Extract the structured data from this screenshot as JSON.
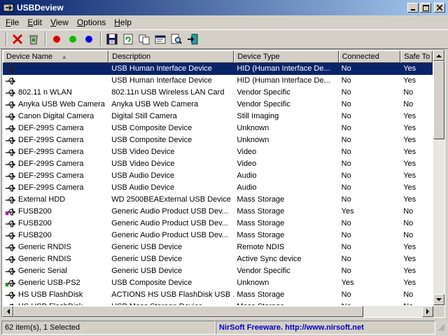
{
  "window": {
    "title": "USBDeview"
  },
  "menu": [
    {
      "label": "File",
      "u": "F",
      "rest": "ile"
    },
    {
      "label": "Edit",
      "u": "E",
      "rest": "dit"
    },
    {
      "label": "View",
      "u": "V",
      "rest": "iew"
    },
    {
      "label": "Options",
      "u": "O",
      "rest": "ptions"
    },
    {
      "label": "Help",
      "u": "H",
      "rest": "elp"
    }
  ],
  "toolbar": {
    "icons": [
      "delete-icon",
      "recycle-icon",
      "red-dot-icon",
      "green-dot-icon",
      "blue-dot-icon",
      "save-icon",
      "refresh-icon",
      "copy-icon",
      "properties-icon",
      "find-icon",
      "exit-icon"
    ],
    "colors": {
      "red": "#e00000",
      "green": "#00c000",
      "blue": "#0000e0"
    }
  },
  "columns": [
    "Device Name",
    "Description",
    "Device Type",
    "Connected",
    "Safe To"
  ],
  "rows": [
    {
      "name": "",
      "desc": "USB Human Interface Device",
      "type": "HID (Human Interface De...",
      "connected": "No",
      "safe": "Yes",
      "icon": "usb-icon",
      "selected": true
    },
    {
      "name": "",
      "desc": "USB Human Interface Device",
      "type": "HID (Human Interface De...",
      "connected": "No",
      "safe": "Yes",
      "icon": "usb-icon"
    },
    {
      "name": "802.11 n WLAN",
      "desc": "802.11n USB Wireless LAN Card",
      "type": "Vendor Specific",
      "connected": "No",
      "safe": "No",
      "icon": "usb-icon"
    },
    {
      "name": "Anyka USB Web Camera",
      "desc": "Anyka USB Web Camera",
      "type": "Vendor Specific",
      "connected": "No",
      "safe": "No",
      "icon": "usb-icon"
    },
    {
      "name": "Canon Digital Camera",
      "desc": "Digital Still Camera",
      "type": "Still Imaging",
      "connected": "No",
      "safe": "Yes",
      "icon": "usb-icon"
    },
    {
      "name": "DEF-299S Camera",
      "desc": "USB Composite Device",
      "type": "Unknown",
      "connected": "No",
      "safe": "Yes",
      "icon": "usb-icon"
    },
    {
      "name": "DEF-299S Camera",
      "desc": "USB Composite Device",
      "type": "Unknown",
      "connected": "No",
      "safe": "Yes",
      "icon": "usb-icon"
    },
    {
      "name": "DEF-299S Camera",
      "desc": "USB Video Device",
      "type": "Video",
      "connected": "No",
      "safe": "Yes",
      "icon": "usb-icon"
    },
    {
      "name": "DEF-299S Camera",
      "desc": "USB Video Device",
      "type": "Video",
      "connected": "No",
      "safe": "Yes",
      "icon": "usb-icon"
    },
    {
      "name": "DEF-299S Camera",
      "desc": "USB Audio Device",
      "type": "Audio",
      "connected": "No",
      "safe": "Yes",
      "icon": "usb-icon"
    },
    {
      "name": "DEF-299S Camera",
      "desc": "USB Audio Device",
      "type": "Audio",
      "connected": "No",
      "safe": "Yes",
      "icon": "usb-icon"
    },
    {
      "name": "External HDD",
      "desc": "WD 2500BEAExternal USB Device",
      "type": "Mass Storage",
      "connected": "No",
      "safe": "Yes",
      "icon": "usb-icon"
    },
    {
      "name": "FUSB200",
      "desc": "Generic Audio   Product USB Dev...",
      "type": "Mass Storage",
      "connected": "Yes",
      "safe": "No",
      "icon": "usb-connected-pink-icon"
    },
    {
      "name": "FUSB200",
      "desc": "Generic Audio   Product USB Dev...",
      "type": "Mass Storage",
      "connected": "No",
      "safe": "No",
      "icon": "usb-icon"
    },
    {
      "name": "FUSB200",
      "desc": "Generic Audio   Product USB Dev...",
      "type": "Mass Storage",
      "connected": "No",
      "safe": "No",
      "icon": "usb-icon"
    },
    {
      "name": "Generic RNDIS",
      "desc": "Generic USB Device",
      "type": "Remote NDIS",
      "connected": "No",
      "safe": "Yes",
      "icon": "usb-icon"
    },
    {
      "name": "Generic RNDIS",
      "desc": "Generic USB Device",
      "type": "Active Sync device",
      "connected": "No",
      "safe": "Yes",
      "icon": "usb-icon"
    },
    {
      "name": "Generic Serial",
      "desc": "Generic USB Device",
      "type": "Vendor Specific",
      "connected": "No",
      "safe": "Yes",
      "icon": "usb-icon"
    },
    {
      "name": "Generic USB-PS2",
      "desc": "USB Composite Device",
      "type": "Unknown",
      "connected": "Yes",
      "safe": "Yes",
      "icon": "usb-connected-green-icon"
    },
    {
      "name": "HS USB FlashDisk",
      "desc": "ACTIONS HS USB FlashDisk USB ...",
      "type": "Mass Storage",
      "connected": "No",
      "safe": "No",
      "icon": "usb-icon"
    },
    {
      "name": "HS USB FlashDisk",
      "desc": "USB Mass Storage Device",
      "type": "Mass Storage",
      "connected": "No",
      "safe": "No",
      "icon": "usb-icon"
    }
  ],
  "status": {
    "count": "62 item(s), 1 Selected",
    "link": "NirSoft Freeware.  http://www.nirsoft.net"
  }
}
